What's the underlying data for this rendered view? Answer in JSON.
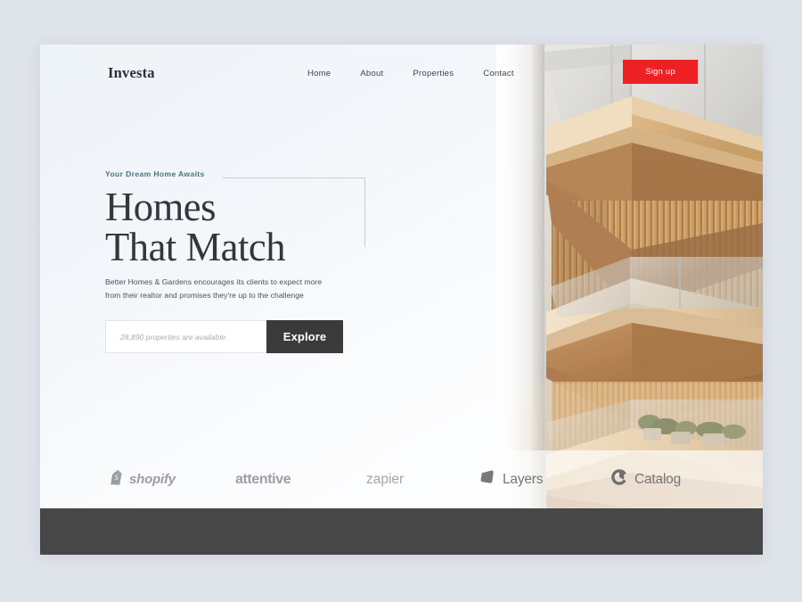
{
  "background_color": "#dfe3ea",
  "card": {
    "background": "#ffffff"
  },
  "nav": {
    "brand": "Investa",
    "links": [
      {
        "label": "Home"
      },
      {
        "label": "About"
      },
      {
        "label": "Properties"
      },
      {
        "label": "Contact"
      }
    ],
    "signup_label": "Sign up",
    "signup_color": "#ed2024"
  },
  "hero": {
    "eyebrow": "Your Dream Home Awaits",
    "eyebrow_color": "#47757f",
    "headline_line1": "Homes",
    "headline_line2": "That Match",
    "subcopy_line1": "Better Homes & Gardens encourages its clients to expect more",
    "subcopy_line2": "from their realtor and promises they're up to the challenge",
    "search_placeholder": "28,890 properties are available",
    "search_value": "",
    "explore_label": "Explore",
    "explore_color": "#3a3a3a"
  },
  "logos": [
    {
      "id": "shopify",
      "label": "shopify",
      "icon": "shopify-bag-icon"
    },
    {
      "id": "attentive",
      "label": "attentive",
      "icon": "none"
    },
    {
      "id": "zapier",
      "label": "zapier",
      "icon": "none"
    },
    {
      "id": "layers",
      "label": "Layers",
      "icon": "layers-rhombus-icon"
    },
    {
      "id": "catalog",
      "label": "Catalog",
      "icon": "catalog-c-icon"
    }
  ],
  "footer": {
    "color": "#474747"
  },
  "photo": {
    "alt": "Modern apartment building with wooden slat balconies and glass railings"
  }
}
